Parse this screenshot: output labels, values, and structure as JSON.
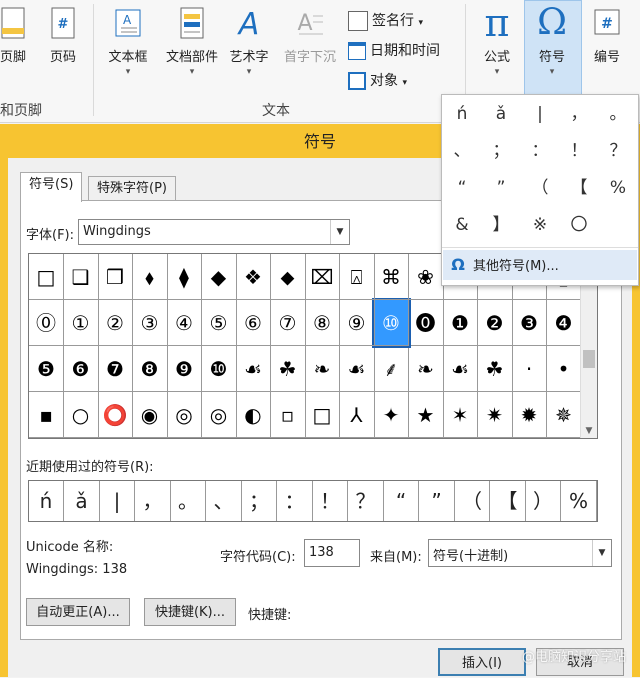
{
  "ribbon": {
    "header_footer_btn": "页脚",
    "page_number_btn": "页码",
    "text_box_btn": "文本框",
    "quick_parts_btn": "文档部件",
    "wordart_btn": "艺术字",
    "dropcap_btn": "首字下沉",
    "signature_line": "签名行",
    "date_time": "日期和时间",
    "object": "对象",
    "equation_btn": "公式",
    "symbol_btn": "符号",
    "number_btn": "编号",
    "group_header_footer": "和页脚",
    "group_text": "文本",
    "equation_glyph": "π",
    "symbol_glyph": "Ω",
    "number_glyph": "#",
    "page_number_glyph": "#",
    "wordart_glyph": "A",
    "dropcap_glyph": "A"
  },
  "symbol_popup": {
    "symbols": [
      "ń",
      "ǎ",
      "|",
      "，",
      "。",
      "、",
      "；",
      "：",
      "！",
      "？",
      "“",
      "”",
      "（",
      "【",
      "%",
      "&",
      "】",
      "※",
      "〇"
    ],
    "more_label": "其他符号(M)...",
    "more_icon": "Ω"
  },
  "dialog": {
    "title": "符号",
    "tab_symbols": "符号(S)",
    "tab_special": "特殊字符(P)",
    "font_label": "字体(F):",
    "font_value": "Wingdings",
    "grid_rows": [
      [
        "□",
        "❑",
        "❒",
        "⬧",
        "⧫",
        "◆",
        "❖",
        "⬥",
        "⌧",
        "⍓",
        "⌘",
        "❀",
        "✿",
        "❝",
        "❞",
        "▯"
      ],
      [
        "⓪",
        "①",
        "②",
        "③",
        "④",
        "⑤",
        "⑥",
        "⑦",
        "⑧",
        "⑨",
        "⑩",
        "⓿",
        "❶",
        "❷",
        "❸",
        "❹"
      ],
      [
        "❺",
        "❻",
        "❼",
        "❽",
        "❾",
        "❿",
        "☙",
        "☘",
        "❧",
        "☙",
        "⸙",
        "❧",
        "☙",
        "☘",
        "·",
        "•"
      ],
      [
        "▪",
        "○",
        "⭕",
        "◉",
        "◎",
        "◎",
        "◐",
        "▫",
        "□",
        "⅄",
        "✦",
        "★",
        "✶",
        "✷",
        "✹",
        "✵"
      ]
    ],
    "selected_cell": "⑩",
    "recent_label": "近期使用过的符号(R):",
    "recent": [
      "ń",
      "ǎ",
      "|",
      "，",
      "。",
      "、",
      "；",
      "：",
      "！",
      "？",
      "“",
      "”",
      "（",
      "【",
      "）",
      "%"
    ],
    "unicode_name_label": "Unicode 名称:",
    "char_name": "Wingdings: 138",
    "char_code_label": "字符代码(C):",
    "char_code_value": "138",
    "from_label": "来自(M):",
    "from_value": "符号(十进制)",
    "autocorrect_btn": "自动更正(A)...",
    "shortcut_btn": "快捷键(K)...",
    "shortcut_label": "快捷键:",
    "insert_btn": "插入(I)",
    "cancel_btn": "取消"
  },
  "watermark": "@电脑知识分享站"
}
